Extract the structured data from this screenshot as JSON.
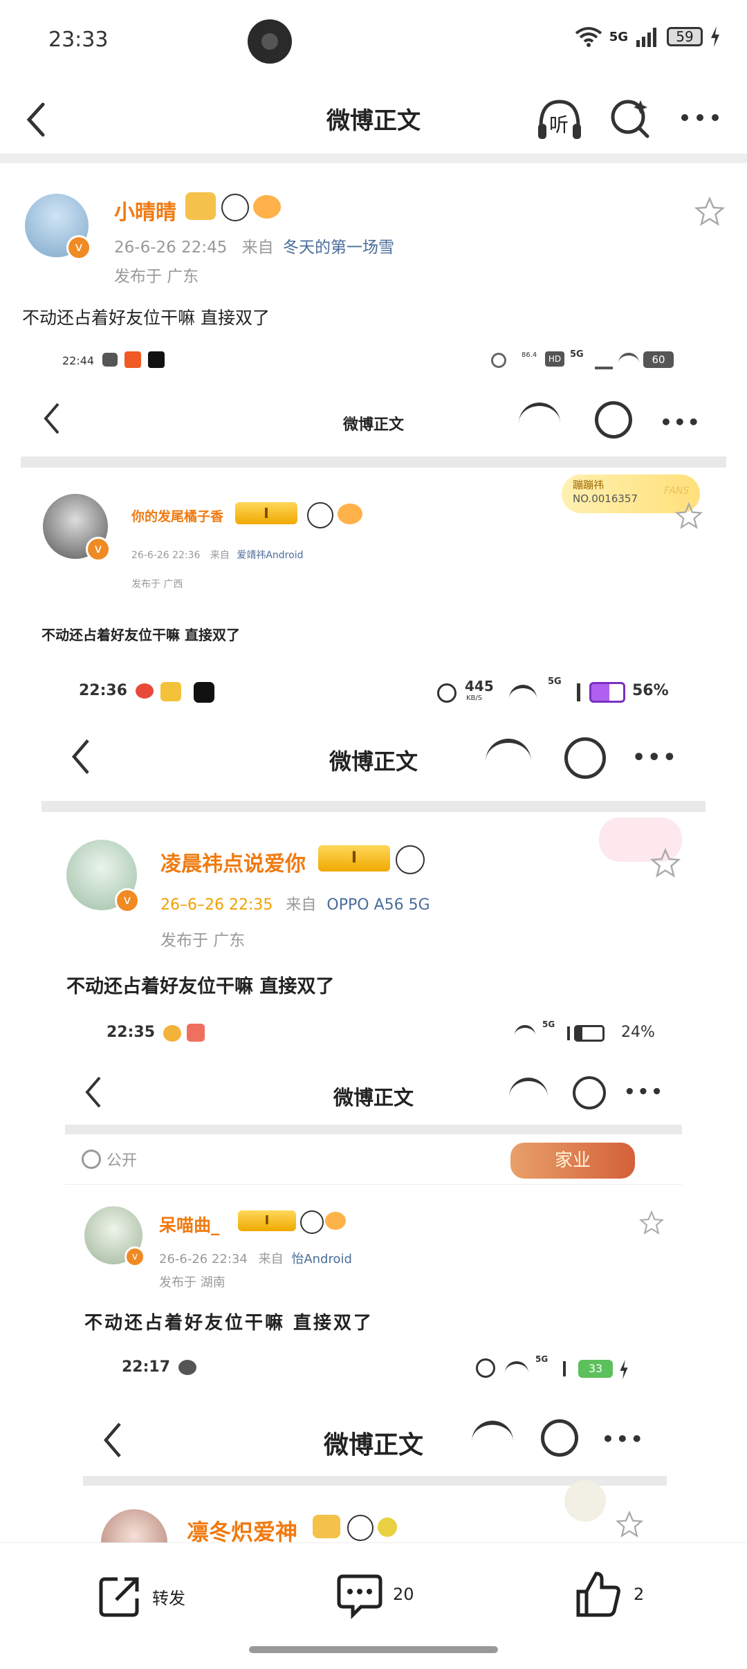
{
  "status_bar": {
    "time": "23:33",
    "network": "5G",
    "battery": "59"
  },
  "header": {
    "title": "微博正文"
  },
  "post": {
    "author": "小晴晴",
    "date": "26-6-26 22:45",
    "from_label": "来自",
    "source": "冬天的第一场雪",
    "location": "发布于 广东",
    "text": "不动还占着好友位干嘛  直接双了"
  },
  "shot1": {
    "time": "22:44",
    "network": "5G",
    "battery": "60",
    "net_speed": "86.4",
    "title": "微博正文",
    "author": "你的发尾橘子香",
    "vip_level": "I",
    "badge_name": "蹦蹦祎",
    "badge_no": "NO.0016357",
    "badge_fans": "FANS",
    "date": "26-6-26   22:36",
    "from_label": "来自",
    "source": "爱靖祎Android",
    "location": "发布于   广西",
    "text": "不动还占着好友位干嘛     直接双了"
  },
  "shot2": {
    "time": "22:36",
    "speed_value": "445",
    "speed_unit": "KB/S",
    "network": "5G",
    "battery_pct": "56%",
    "title": "微博正文",
    "author": "凌晨祎点说爱你",
    "vip_level": "I",
    "date": "26–6–26  22:35",
    "from_label": "来自",
    "source": "OPPO  A56  5G",
    "location": "发布于  广东",
    "text": "不动还占着好友位干嘛    直接双了"
  },
  "shot3": {
    "time": "22:35",
    "network": "5G",
    "battery_pct": "24%",
    "title": "微博正文",
    "visibility": "公开",
    "banner": "家业",
    "author": "呆喵曲_",
    "vip_level": "I",
    "date": "26-6-26 22:34",
    "from_label": "来自",
    "source": "怡Android",
    "location": "发布于  湖南",
    "text": "不动还占着好友位干嘛  直接双了"
  },
  "shot4": {
    "time": "22:17",
    "network": "5G",
    "battery": "33",
    "title": "微博正文",
    "author": "凛冬炽爱神"
  },
  "listen_label": "听",
  "bottom_bar": {
    "repost_label": "转发",
    "comment_count": "20",
    "like_count": "2"
  },
  "colors": {
    "accent": "#f07a10",
    "link": "#4a6d9a",
    "vip_gold": "#f0a900"
  }
}
